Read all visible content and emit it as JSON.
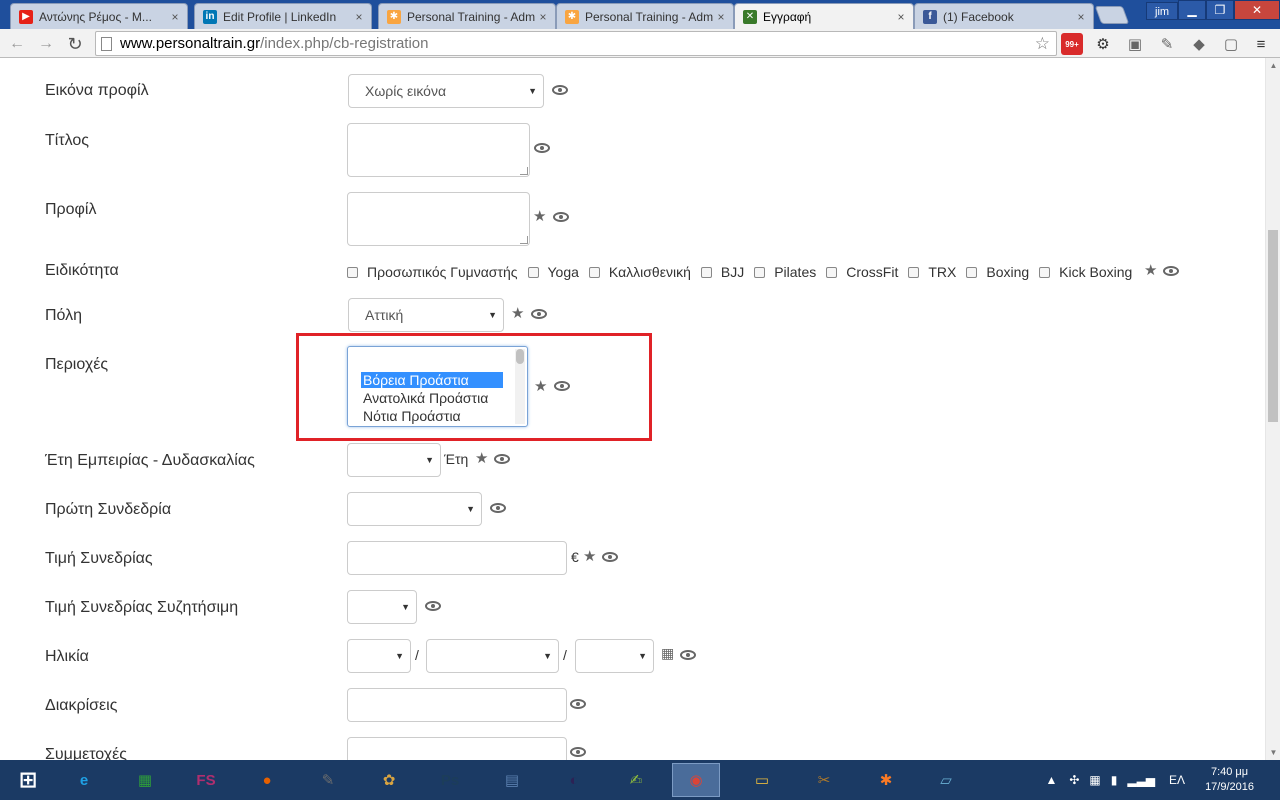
{
  "browser": {
    "tabs": [
      {
        "title": "Αντώνης Ρέμος - Μ...",
        "favicon": "youtube-icon",
        "color": "#e62117",
        "glyph": "▶"
      },
      {
        "title": "Edit Profile | LinkedIn",
        "favicon": "linkedin-icon",
        "color": "#0077b5",
        "glyph": "in"
      },
      {
        "title": "Personal Training - Adm",
        "favicon": "joomla-icon",
        "color": "#f9a541",
        "glyph": "✱"
      },
      {
        "title": "Personal Training - Adm",
        "favicon": "joomla-icon",
        "color": "#f9a541",
        "glyph": "✱"
      },
      {
        "title": "Εγγραφή",
        "favicon": "site-icon",
        "color": "#3a7a2a",
        "glyph": "✕"
      },
      {
        "title": "(1) Facebook",
        "favicon": "facebook-icon",
        "color": "#3b5998",
        "glyph": "f"
      }
    ],
    "tab_close": "×",
    "user": "jim",
    "url_host": "www.personaltrain.gr",
    "url_path": "/index.php/cb-registration",
    "ext_badge": "99+"
  },
  "form": {
    "avatar": {
      "label": "Εικόνα προφίλ",
      "value": "Χωρίς εικόνα"
    },
    "title": {
      "label": "Τίτλος"
    },
    "profile": {
      "label": "Προφίλ"
    },
    "specialty": {
      "label": "Ειδικότητα",
      "options": [
        "Προσωπικός Γυμναστής",
        "Yoga",
        "Καλλισθενική",
        "BJJ",
        "Pilates",
        "CrossFit",
        "TRX",
        "Boxing",
        "Kick Boxing"
      ]
    },
    "city": {
      "label": "Πόλη",
      "value": "Αττική"
    },
    "areas": {
      "label": "Περιοχές",
      "options": [
        "Βόρεια Προάστια",
        "Ανατολικά Προάστια",
        "Νότια Προάστια"
      ],
      "selected_index": 0
    },
    "experience": {
      "label": "Έτη Εμπειρίας - Δυδασκαλίας",
      "suffix": "Έτη"
    },
    "first_session": {
      "label": "Πρώτη Συνδεδρία"
    },
    "price": {
      "label": "Τιμή Συνεδρίας",
      "suffix": "€"
    },
    "negotiable": {
      "label": "Τιμή Συνεδρίας Συζητήσιμη"
    },
    "age": {
      "label": "Ηλικία",
      "separator": "/"
    },
    "awards": {
      "label": "Διακρίσεις"
    },
    "participations": {
      "label": "Συμμετοχές"
    }
  },
  "taskbar": {
    "apps": [
      {
        "name": "ie-icon",
        "glyph": "e",
        "color": "#1fa0e4"
      },
      {
        "name": "store-icon",
        "glyph": "▦",
        "color": "#2e9e3a"
      },
      {
        "name": "fs-app-icon",
        "glyph": "FS",
        "color": "#b02e6e"
      },
      {
        "name": "firefox-icon",
        "glyph": "●",
        "color": "#e66000"
      },
      {
        "name": "gimp-icon",
        "glyph": "✎",
        "color": "#6e6e6e"
      },
      {
        "name": "paint-icon",
        "glyph": "✿",
        "color": "#d9a441"
      },
      {
        "name": "photoshop-icon",
        "glyph": "Ps",
        "color": "#1c3d5a"
      },
      {
        "name": "calculator-icon",
        "glyph": "▤",
        "color": "#5a7fae"
      },
      {
        "name": "eclipse-icon",
        "glyph": "◐",
        "color": "#2c2255"
      },
      {
        "name": "notepadpp-icon",
        "glyph": "✍",
        "color": "#8fbc3c"
      },
      {
        "name": "chrome-icon",
        "glyph": "◉",
        "color": "#db4437"
      },
      {
        "name": "file-explorer-icon",
        "glyph": "▭",
        "color": "#e8b93c"
      },
      {
        "name": "tools-icon",
        "glyph": "✂",
        "color": "#b07a2a"
      },
      {
        "name": "xampp-icon",
        "glyph": "✱",
        "color": "#fb7a24"
      },
      {
        "name": "notes-icon",
        "glyph": "▱",
        "color": "#6ab0d4"
      }
    ],
    "active_index": 10,
    "language": "ΕΛ",
    "time": "7:40 μμ",
    "date": "17/9/2016"
  }
}
